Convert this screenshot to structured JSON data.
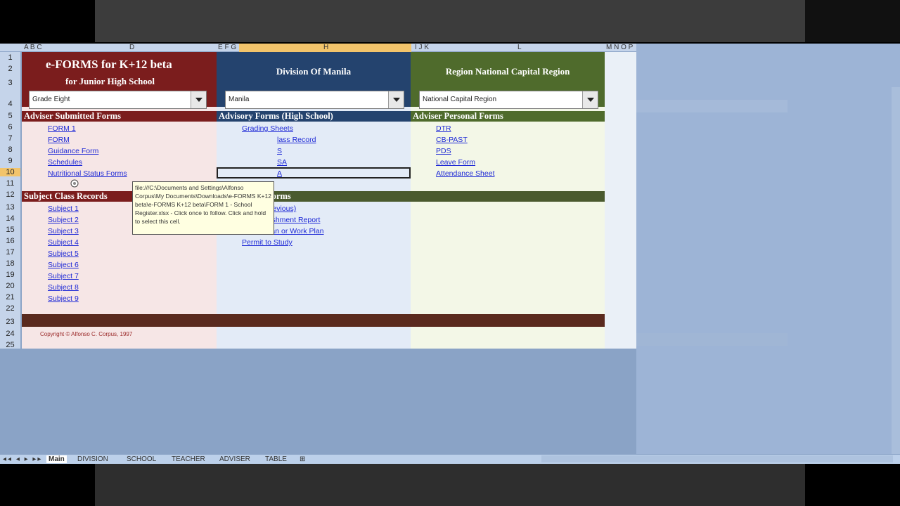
{
  "columns": [
    "A B C",
    "D",
    "E F G",
    "H",
    "I J K",
    "L",
    "M N O P"
  ],
  "rows": [
    "1",
    "2",
    "3",
    "4",
    "5",
    "6",
    "7",
    "8",
    "9",
    "10",
    "11",
    "12",
    "13",
    "14",
    "15",
    "16",
    "17",
    "18",
    "19",
    "20",
    "21",
    "22",
    "23",
    "24",
    "25"
  ],
  "header": {
    "title": "e-FORMS for K+12 beta",
    "subtitle": "for Junior High School",
    "division": "Division Of Manila",
    "region": "Region National Capital Region"
  },
  "combos": {
    "grade": "Grade Eight",
    "division": "Manila",
    "region": "National Capital Region"
  },
  "sections": {
    "adviser_submitted": "Adviser Submitted Forms",
    "advisory": "Advisory Forms (High School)",
    "adviser_personal": "Adviser Personal Forms",
    "subject_records": "Subject Class Records",
    "stand_alone": "Stand Alone Forms"
  },
  "adviser_submitted_links": [
    "FORM 1",
    "FORM",
    "Guidance Form",
    "Schedules",
    "Nutritional Status Forms"
  ],
  "advisory_links": [
    "Grading Sheets",
    "lass Record",
    "S",
    "SA",
    "A"
  ],
  "adviser_personal_links": [
    "DTR",
    "CB-PAST",
    "PDS",
    "Leave Form",
    "Attendance Sheet"
  ],
  "subject_links": [
    "Subject 1",
    "Subject 2",
    "Subject 3",
    "Subject 4",
    "Subject 5",
    "Subject 6",
    "Subject 7",
    "Subject 8",
    "Subject 9"
  ],
  "stand_alone_links": [
    "PAST (Previous)",
    "Accomplishment Report",
    "Action Plan or Work Plan",
    "Permit to Study"
  ],
  "copyright": "Copyright © Alfonso C. Corpus, 1997",
  "tooltip": "file:///C:\\Documents and Settings\\Alfonso Corpus\\My Documents\\Downloads\\e-FORMS K+12 beta\\e-FORMS K+12 beta\\FORM 1 - School Register.xlsx - Click once to follow. Click and hold to select this cell.",
  "sheet_tabs": [
    "Main",
    "DIVISION",
    "SCHOOL",
    "TEACHER",
    "ADVISER",
    "TABLE"
  ],
  "colors": {
    "red": "#7b1d1d",
    "blue": "#24436e",
    "green": "#4f6b2c",
    "link": "#1f2ad6"
  }
}
